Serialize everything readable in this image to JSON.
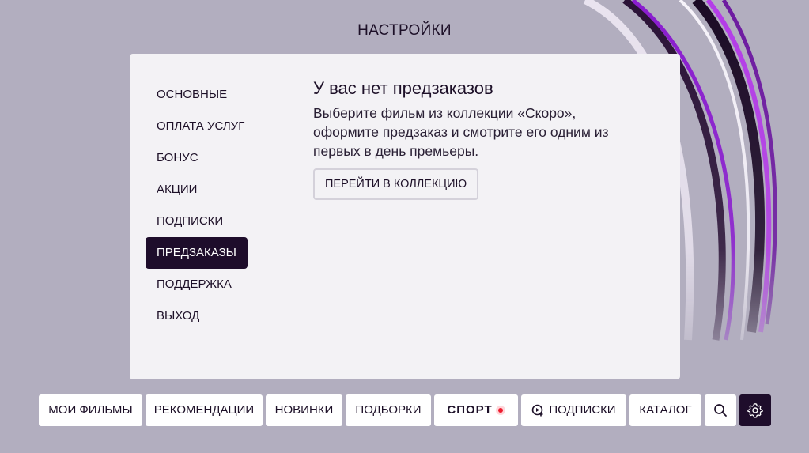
{
  "page": {
    "title": "НАСТРОЙКИ"
  },
  "sidebar": {
    "items": [
      {
        "label": "ОСНОВНЫЕ",
        "active": false
      },
      {
        "label": "ОПЛАТА УСЛУГ",
        "active": false
      },
      {
        "label": "БОНУС",
        "active": false
      },
      {
        "label": "АКЦИИ",
        "active": false
      },
      {
        "label": "ПОДПИСКИ",
        "active": false
      },
      {
        "label": "ПРЕДЗАКАЗЫ",
        "active": true
      },
      {
        "label": "ПОДДЕРЖКА",
        "active": false
      },
      {
        "label": "ВЫХОД",
        "active": false
      }
    ]
  },
  "content": {
    "title": "У вас нет предзаказов",
    "lines": [
      "Выберите фильм из коллекции «Скоро»,",
      "оформите предзаказ и смотрите его одним из",
      "первых в день премьеры."
    ],
    "button_label": "ПЕРЕЙТИ В КОЛЛЕКЦИЮ"
  },
  "bottom_nav": {
    "items": [
      {
        "label": "МОИ ФИЛЬМЫ"
      },
      {
        "label": "РЕКОМЕНДАЦИИ"
      },
      {
        "label": "НОВИНКИ"
      },
      {
        "label": "ПОДБОРКИ"
      },
      {
        "label": "СПОРТ",
        "icon": "live-dot-icon"
      },
      {
        "label": "ПОДПИСКИ",
        "icon": "subscription-plus-icon"
      },
      {
        "label": "КАТАЛОГ"
      },
      {
        "label": "",
        "icon": "search-icon"
      },
      {
        "label": "",
        "icon": "gear-icon",
        "active": true
      }
    ]
  },
  "colors": {
    "background": "#b2aebf",
    "panel": "#f3f2f5",
    "accent_dark": "#1e0d2b",
    "live_red": "#ee1d2f",
    "ring_purple": "#9b1fd6"
  }
}
